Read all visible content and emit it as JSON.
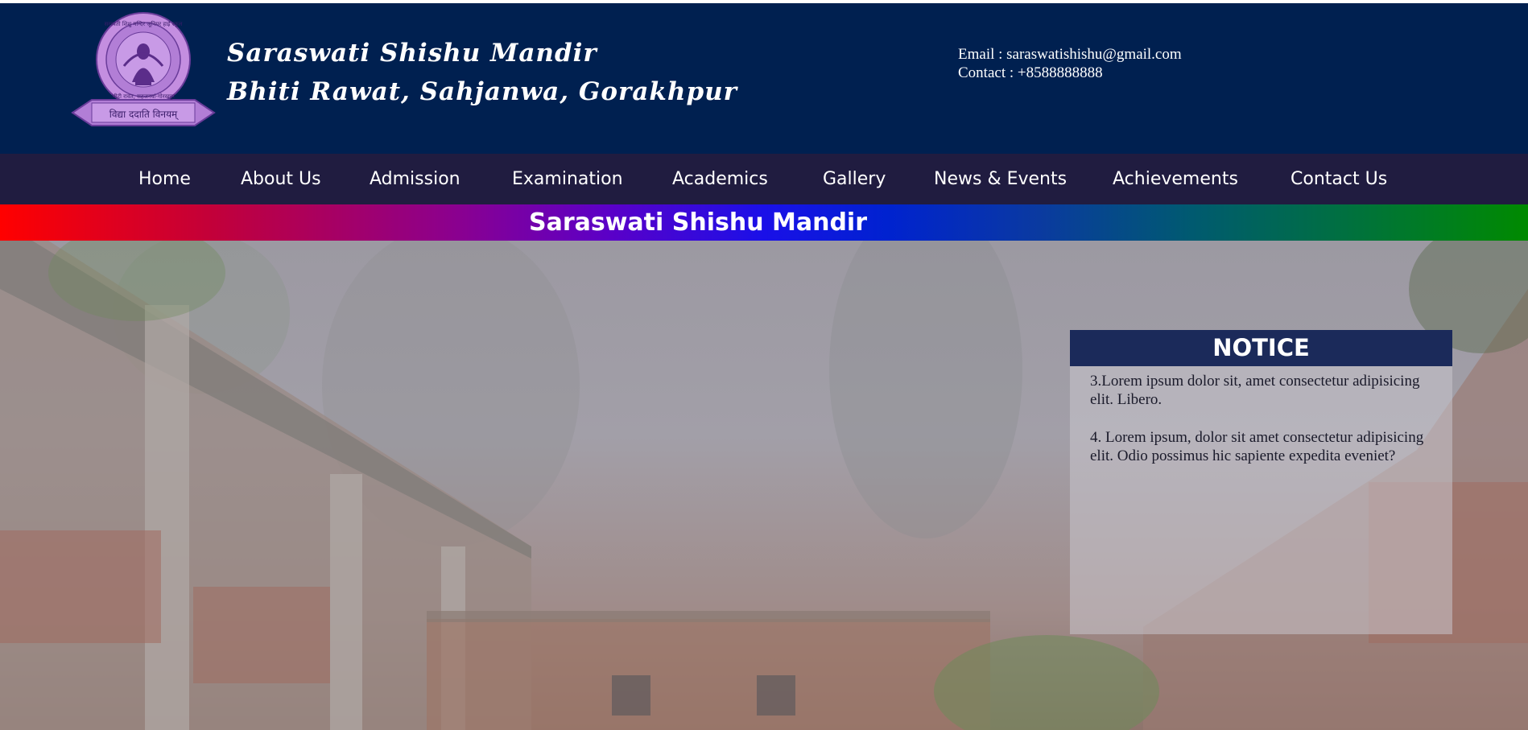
{
  "header": {
    "name_line1": "Saraswati Shishu Mandir",
    "name_line2": "Bhiti Rawat, Sahjanwa, Gorakhpur",
    "email": "Email : saraswatishishu@gmail.com",
    "contact": "Contact : +8588888888",
    "logo": {
      "icon": "school-crest-icon",
      "top_text": "सरस्वती शिशु मन्दिर जूनियर हाई स्कूल",
      "bottom_text": "भीटी रावत, सहजनवां-गोरखपुर",
      "motto": "विद्या ददाति विनयम्"
    }
  },
  "nav": {
    "items": [
      "Home",
      "About Us",
      "Admission",
      "Examination",
      "Academics",
      "Gallery",
      "News & Events",
      "Achievements",
      "Contact Us"
    ]
  },
  "banner": {
    "title": "Saraswati Shishu Mandir"
  },
  "notice": {
    "title": "NOTICE",
    "items": [
      "3.Lorem ipsum dolor sit, amet consectetur adipisicing elit. Libero.",
      "4. Lorem ipsum, dolor sit amet consectetur adipisicing elit. Odio possimus hic sapiente expedita eveniet?"
    ]
  },
  "colors": {
    "header_bg": "#002050",
    "nav_bg": "#201c40",
    "notice_head_bg": "#1b2a5a",
    "banner_start": "#ff0000",
    "banner_mid": "#1a10e8",
    "banner_end": "#008a00"
  }
}
